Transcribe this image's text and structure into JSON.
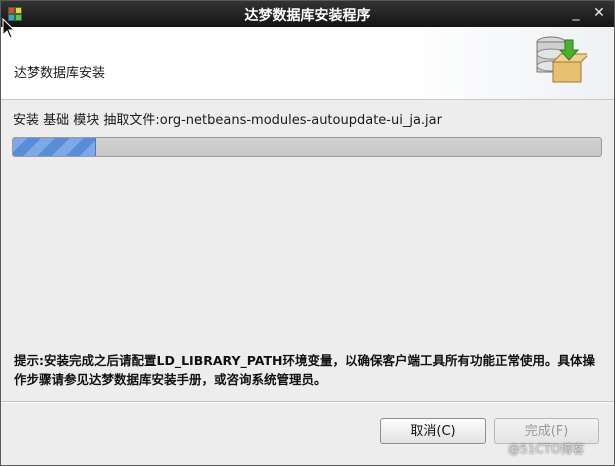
{
  "window": {
    "title": "达梦数据库安装程序"
  },
  "controls": {
    "minimize": "_",
    "close": "✕"
  },
  "header": {
    "heading": "达梦数据库安装"
  },
  "status": {
    "text": "安装 基础 模块 抽取文件:org-netbeans-modules-autoupdate-ui_ja.jar"
  },
  "progress": {
    "fraction": 0.14
  },
  "tip": {
    "text": "提示:安装完成之后请配置LD_LIBRARY_PATH环境变量，以确保客户端工具所有功能正常使用。具体操作步骤请参见达梦数据库安装手册，或咨询系统管理员。"
  },
  "buttons": {
    "cancel": "取消(C)",
    "finish": "完成(F)"
  },
  "watermark": "@51CTO博客",
  "colors": {
    "titlebar": "#1e1e1e",
    "progress_fill": "#6a9ae0"
  }
}
